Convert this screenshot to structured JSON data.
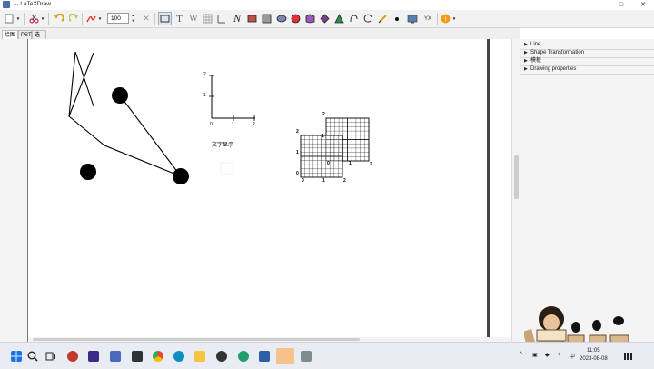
{
  "window": {
    "title": "··· LaTeXDraw",
    "minimize": "–",
    "maximize": "□",
    "close": "✕"
  },
  "toolbar": {
    "zoom_value": "100",
    "text_tool": "T",
    "wave_tool": "W",
    "freehand_tool": "N",
    "yx_tool": "YX",
    "spin_up": "▲",
    "spin_down": "▼",
    "icons": [
      "new-icon",
      "cut-icon",
      "undo-icon",
      "redo-icon",
      "pdf-icon",
      "delete-icon",
      "select-tool-icon",
      "text-tool-icon",
      "wave-tool-icon",
      "grid-tool-icon",
      "freehand-tool-icon",
      "rectangle-tool-icon",
      "square-tool-icon",
      "ellipse-tool-icon",
      "circle-tool-icon",
      "polygon-tool-icon",
      "rhombus-tool-icon",
      "triangle-tool-icon",
      "bezier-tool-icon",
      "arc-tool-icon",
      "pencil-tool-icon",
      "dot-tool-icon",
      "picture-tool-icon",
      "plot-tool-icon",
      "help-icon"
    ]
  },
  "tabs": [
    {
      "label": "绘图",
      "active": true
    },
    {
      "label": "PST",
      "active": false
    },
    {
      "label": "选项",
      "active": false
    }
  ],
  "panel": {
    "sections": [
      {
        "label": "Line"
      },
      {
        "label": "Shape Transformation"
      },
      {
        "label": "模板"
      },
      {
        "label": "Drawing properties"
      }
    ]
  },
  "canvas": {
    "axes_labels": {
      "y2": "2",
      "y1": "1",
      "x0": "0",
      "x1": "1",
      "x2": "2"
    },
    "text_shape": "文字显示",
    "grid1_labels": {
      "top": "2",
      "mid": "1",
      "bottom": "0",
      "x0": "0",
      "x1": "1",
      "x2": "2"
    },
    "grid2_labels": {
      "top": "2",
      "mid": "1",
      "bottom": "0",
      "x1": "1",
      "x2": "2"
    }
  },
  "taskbar": {
    "clock_time": "11:05",
    "clock_date": "2023-08-08",
    "lang": "中",
    "icons": [
      "windows-start-icon",
      "search-icon",
      "task-view-icon",
      "app-red-icon",
      "app-purple-icon",
      "app-grid-icon",
      "app-zy-icon",
      "chrome-icon",
      "edge-icon",
      "explorer-icon",
      "app-terminal-icon",
      "app-green-icon",
      "app-doc-icon",
      "app-orange-icon",
      "app-paint-icon"
    ]
  },
  "colors": {
    "accent": "#4a6fa5",
    "canvas_bg": "#ffffff",
    "panel_bg": "#f4f4f4"
  }
}
